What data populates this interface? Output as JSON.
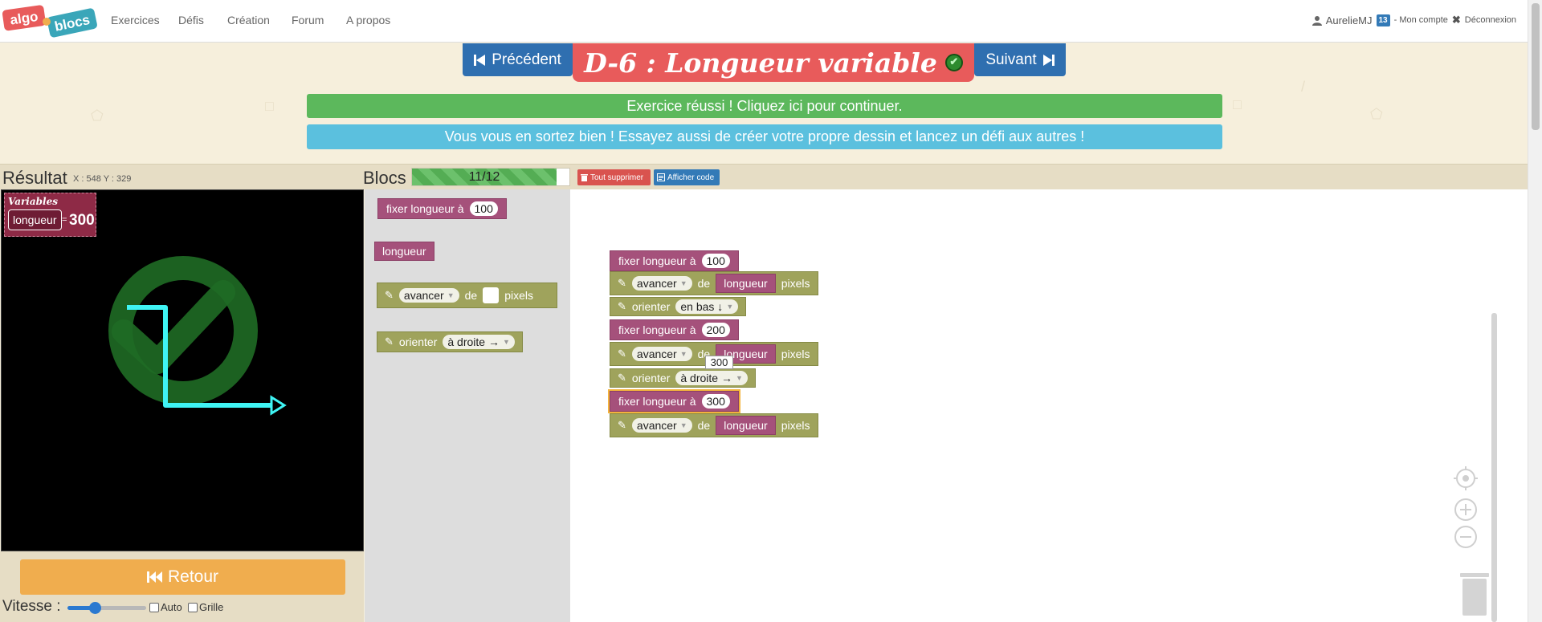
{
  "nav": {
    "logo_word1": "algo",
    "logo_word2": "blocs",
    "items": [
      "Exercices",
      "Défis",
      "Création",
      "Forum",
      "A propos"
    ],
    "user": "AurelieMJ",
    "badge": "13",
    "account": "- Mon compte",
    "logout": "Déconnexion"
  },
  "header": {
    "prev_label": "Précédent",
    "next_label": "Suivant",
    "title": "D-6 : Longueur variable",
    "success_banner": "Exercice réussi ! Cliquez ici pour continuer.",
    "info_banner": "Vous vous en sortez bien ! Essayez aussi de créer votre propre dessin et lancez un défi aux autres !"
  },
  "result": {
    "title": "Résultat",
    "coords": "X : 548 Y : 329",
    "vars_title": "Variables",
    "var_name": "longueur",
    "var_eq": "=",
    "var_value": "300"
  },
  "blocs": {
    "title": "Blocs",
    "progress_text": "11/12",
    "progress_fraction": 0.917,
    "delete_all": "Tout supprimer",
    "show_code": "Afficher code"
  },
  "toolbox": {
    "set_label": "fixer longueur à",
    "set_value": "100",
    "var_label": "longueur",
    "move_label": "avancer",
    "move_de": "de",
    "move_unit": "pixels",
    "orient_label": "orienter",
    "orient_value": "à droite →"
  },
  "workspace": {
    "set1_label": "fixer longueur à",
    "set1_value": "100",
    "move1_label": "avancer",
    "move1_de": "de",
    "move1_var": "longueur",
    "move1_unit": "pixels",
    "orient1_label": "orienter",
    "orient1_value": "en bas ↓",
    "set2_label": "fixer longueur à",
    "set2_value": "200",
    "move2_label": "avancer",
    "move2_de": "de",
    "move2_var": "longueur",
    "move2_unit": "pixels",
    "tooltip_value": "300",
    "orient2_label": "orienter",
    "orient2_value": "à droite →",
    "set3_label": "fixer longueur à",
    "set3_value": "300",
    "move3_label": "avancer",
    "move3_de": "de",
    "move3_var": "longueur",
    "move3_unit": "pixels"
  },
  "controls": {
    "retour_label": "Retour",
    "speed_label": "Vitesse :",
    "speed_fraction": 0.35,
    "auto_label": "Auto",
    "grid_label": "Grille"
  },
  "colors": {
    "accent_blue": "#2f6fb0",
    "title_red": "#e85b5b",
    "success_green": "#5cb85c",
    "info_cyan": "#5bc0de",
    "var_block": "#a5517b",
    "move_block": "#9fa35c",
    "retour_orange": "#f0ad4e",
    "trace_cyan": "#3ff4f4"
  },
  "icons": [
    "user-icon",
    "close-icon",
    "step-backward-icon",
    "step-forward-icon",
    "check-circle-icon",
    "trash-icon",
    "code-icon",
    "fast-backward-icon",
    "pencil-icon",
    "target-icon",
    "zoom-in-icon",
    "zoom-out-icon"
  ]
}
